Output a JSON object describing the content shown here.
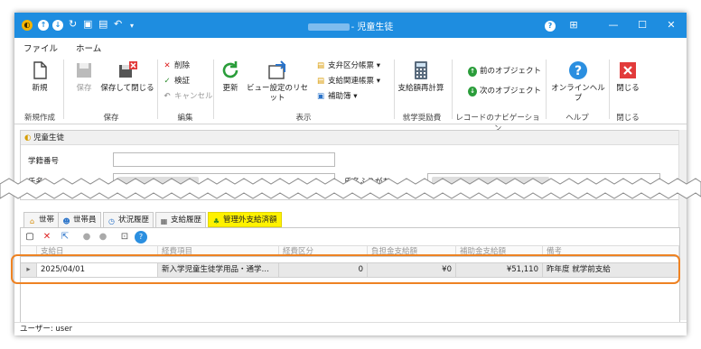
{
  "window": {
    "title_suffix": "- 児童生徒",
    "controls": {
      "help": "?",
      "pin": "⊞",
      "minimize": "—",
      "maximize": "☐",
      "close": "✕"
    }
  },
  "menu": {
    "file": "ファイル",
    "home": "ホーム"
  },
  "ribbon": {
    "new": "新規",
    "save": "保存",
    "save_close": "保存して閉じる",
    "delete": "削除",
    "verify": "検証",
    "cancel": "キャンセル",
    "refresh": "更新",
    "view_reset": "ビュー設定のリセット",
    "payment_category_form": "支弁区分帳票",
    "payment_related_form": "支給関連帳票",
    "supplement_book": "補助簿",
    "recalc_amount": "支給額再計算",
    "prev_object": "前のオブジェクト",
    "next_object": "次のオブジェクト",
    "online_help": "オンラインヘルプ",
    "close": "閉じる",
    "groups": {
      "create": "新規作成",
      "save": "保存",
      "edit": "編集",
      "display": "表示",
      "aid": "就学奨励費",
      "record_nav": "レコードのナビゲーション",
      "help": "ヘルプ",
      "close": "閉じる"
    }
  },
  "panel": {
    "title": "児童生徒",
    "student_number_label": "学籍番号",
    "name_label": "氏名",
    "required_mark": "*",
    "kana_label": "氏名ふりがな"
  },
  "tabs": [
    {
      "label": "世帯"
    },
    {
      "label": "世帯員"
    },
    {
      "label": "状況履歴"
    },
    {
      "label": "支給履歴"
    },
    {
      "label": "管理外支給済額"
    }
  ],
  "grid": {
    "columns": [
      "支給日",
      "経費項目",
      "経費区分",
      "負担金支給額",
      "補助金支給額",
      "備考"
    ],
    "rows": [
      {
        "indicator": "▸",
        "date": "2025/04/01",
        "item": "新入学児童生徒学用品・通学…",
        "count": "0",
        "burden": "¥0",
        "subsidy": "¥51,110",
        "note": "昨年度 就学前支給"
      }
    ]
  },
  "status": {
    "user": "ユーザー: user"
  },
  "colors": {
    "titlebar": "#1e8de0",
    "highlight": "#fff200",
    "overlay": "#ee8222"
  }
}
